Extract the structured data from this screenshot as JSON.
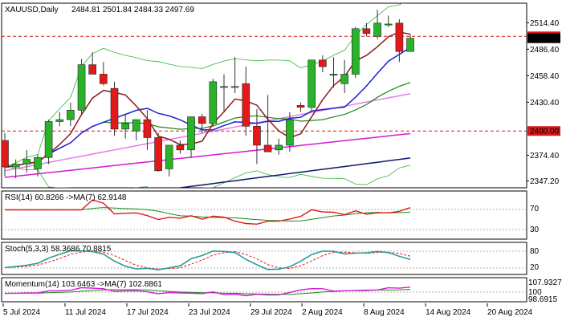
{
  "main_panel": {
    "title": "XAUUSD,Daily",
    "ohlc": "2484.81 2501.84 2484.33 2497.69",
    "y_ticks": [
      "2514.40",
      "2486.40",
      "2458.40",
      "2430.40",
      "2374.40",
      "2347.20"
    ],
    "levels": [
      {
        "label": "2500.00",
        "value": 2500
      },
      {
        "label": "2400.00",
        "value": 2400
      }
    ],
    "current_price_label": "2497.69"
  },
  "chart_data": {
    "type": "candlestick",
    "ylim": [
      2340,
      2535
    ],
    "candles": [
      {
        "o": 2390,
        "h": 2398,
        "l": 2352,
        "c": 2362
      },
      {
        "o": 2362,
        "h": 2370,
        "l": 2350,
        "c": 2365
      },
      {
        "o": 2365,
        "h": 2380,
        "l": 2356,
        "c": 2370
      },
      {
        "o": 2360,
        "h": 2375,
        "l": 2352,
        "c": 2372
      },
      {
        "o": 2372,
        "h": 2412,
        "l": 2365,
        "c": 2410
      },
      {
        "o": 2410,
        "h": 2420,
        "l": 2405,
        "c": 2412
      },
      {
        "o": 2412,
        "h": 2430,
        "l": 2405,
        "c": 2422
      },
      {
        "o": 2422,
        "h": 2476,
        "l": 2418,
        "c": 2470
      },
      {
        "o": 2470,
        "h": 2483,
        "l": 2460,
        "c": 2460
      },
      {
        "o": 2460,
        "h": 2473,
        "l": 2448,
        "c": 2450
      },
      {
        "o": 2445,
        "h": 2452,
        "l": 2395,
        "c": 2402
      },
      {
        "o": 2402,
        "h": 2418,
        "l": 2392,
        "c": 2408
      },
      {
        "o": 2400,
        "h": 2412,
        "l": 2390,
        "c": 2412
      },
      {
        "o": 2412,
        "h": 2422,
        "l": 2380,
        "c": 2393
      },
      {
        "o": 2393,
        "h": 2398,
        "l": 2357,
        "c": 2358
      },
      {
        "o": 2360,
        "h": 2385,
        "l": 2352,
        "c": 2385
      },
      {
        "o": 2385,
        "h": 2390,
        "l": 2376,
        "c": 2380
      },
      {
        "o": 2380,
        "h": 2415,
        "l": 2372,
        "c": 2415
      },
      {
        "o": 2415,
        "h": 2418,
        "l": 2398,
        "c": 2408
      },
      {
        "o": 2408,
        "h": 2455,
        "l": 2406,
        "c": 2452
      },
      {
        "o": 2447,
        "h": 2460,
        "l": 2420,
        "c": 2447
      },
      {
        "o": 2447,
        "h": 2478,
        "l": 2440,
        "c": 2447
      },
      {
        "o": 2450,
        "h": 2468,
        "l": 2395,
        "c": 2405
      },
      {
        "o": 2405,
        "h": 2423,
        "l": 2365,
        "c": 2385
      },
      {
        "o": 2385,
        "h": 2438,
        "l": 2380,
        "c": 2378
      },
      {
        "o": 2380,
        "h": 2392,
        "l": 2375,
        "c": 2385
      },
      {
        "o": 2385,
        "h": 2420,
        "l": 2378,
        "c": 2412
      },
      {
        "o": 2427,
        "h": 2430,
        "l": 2420,
        "c": 2425
      },
      {
        "o": 2425,
        "h": 2475,
        "l": 2420,
        "c": 2475
      },
      {
        "o": 2475,
        "h": 2480,
        "l": 2462,
        "c": 2468
      },
      {
        "o": 2460,
        "h": 2478,
        "l": 2446,
        "c": 2460
      },
      {
        "o": 2450,
        "h": 2475,
        "l": 2440,
        "c": 2460
      },
      {
        "o": 2460,
        "h": 2510,
        "l": 2456,
        "c": 2508
      },
      {
        "o": 2508,
        "h": 2514,
        "l": 2500,
        "c": 2503
      },
      {
        "o": 2500,
        "h": 2528,
        "l": 2497,
        "c": 2514
      },
      {
        "o": 2513,
        "h": 2522,
        "l": 2510,
        "c": 2513
      },
      {
        "o": 2514,
        "h": 2518,
        "l": 2473,
        "c": 2484
      },
      {
        "o": 2484,
        "h": 2502,
        "l": 2484,
        "c": 2498
      }
    ],
    "dates": [
      "5 Jul 2024",
      "11 Jul 2024",
      "17 Jul 2024",
      "23 Jul 2024",
      "29 Jul 2024",
      "2 Aug 2024",
      "8 Aug 2024",
      "14 Aug 2024",
      "20 Aug 2024"
    ],
    "date_candle_index": [
      0,
      6,
      12,
      18,
      24,
      29,
      35,
      41,
      47
    ]
  },
  "colors": {
    "bull": "#29b329",
    "bear": "#e31919",
    "bb": "#35b535",
    "ma_fast": "#8b1a1a",
    "ma_mid": "#1f1fd6",
    "ma_green": "#1a8a1a",
    "ma_pink": "#e87ae8",
    "ma_magenta": "#d31bd3",
    "ma_navy": "#0d1a66",
    "level": "#d31919"
  },
  "rsi_panel": {
    "title": "RSI(14) 60.8266 ->MA(7) 62.9148",
    "y_ticks": [
      "70",
      "30"
    ]
  },
  "stoch_panel": {
    "title": "Stoch(5,3,3) 58.3686 70.8815",
    "y_ticks": [
      "80",
      "20"
    ]
  },
  "mom_panel": {
    "title": "Momentum(14) 103.6463 ->MA(7) 102.8861",
    "y_ticks": [
      "107.9327",
      "100",
      "98.6915"
    ]
  }
}
